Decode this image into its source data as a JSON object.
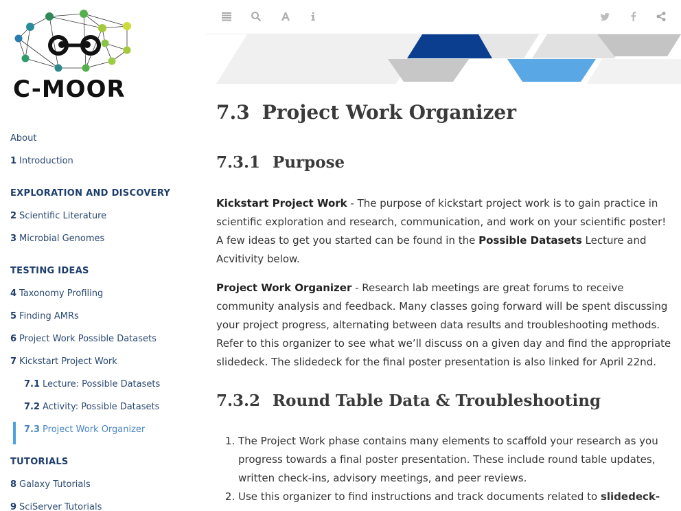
{
  "logo": {
    "text": "C-MOOR"
  },
  "sidebar": {
    "items": [
      {
        "kind": "entry",
        "num": "",
        "label": "About"
      },
      {
        "kind": "entry",
        "num": "1",
        "label": "Introduction"
      },
      {
        "kind": "gap"
      },
      {
        "kind": "part",
        "label": "Exploration and Discovery"
      },
      {
        "kind": "entry",
        "num": "2",
        "label": "Scientific Literature"
      },
      {
        "kind": "entry",
        "num": "3",
        "label": "Microbial Genomes"
      },
      {
        "kind": "gap"
      },
      {
        "kind": "part",
        "label": "Testing Ideas"
      },
      {
        "kind": "entry",
        "num": "4",
        "label": "Taxonomy Profiling"
      },
      {
        "kind": "entry",
        "num": "5",
        "label": "Finding AMRs"
      },
      {
        "kind": "entry",
        "num": "6",
        "label": "Project Work Possible Datasets"
      },
      {
        "kind": "entry",
        "num": "7",
        "label": "Kickstart Project Work"
      },
      {
        "kind": "sub",
        "num": "7.1",
        "label": "Lecture: Possible Datasets"
      },
      {
        "kind": "sub",
        "num": "7.2",
        "label": "Activity: Possible Datasets"
      },
      {
        "kind": "sub",
        "num": "7.3",
        "label": "Project Work Organizer",
        "active": true
      },
      {
        "kind": "gap"
      },
      {
        "kind": "part",
        "label": "Tutorials"
      },
      {
        "kind": "entry",
        "num": "8",
        "label": "Galaxy Tutorials"
      },
      {
        "kind": "entry",
        "num": "9",
        "label": "SciServer Tutorials"
      }
    ]
  },
  "toolbar": {
    "left_icons": [
      "toggle-sidebar-icon",
      "search-icon",
      "font-settings-icon",
      "info-icon"
    ],
    "right_icons": [
      "twitter-icon",
      "facebook-icon",
      "share-icon"
    ]
  },
  "main": {
    "chapter": {
      "num": "7.3",
      "title": "Project Work Organizer"
    },
    "sections": {
      "purpose": {
        "num": "7.3.1",
        "title": "Purpose"
      },
      "roundtable": {
        "num": "7.3.2",
        "title": "Round Table Data & Troubleshooting"
      }
    },
    "para1": {
      "bold1": "Kickstart Project Work",
      "text1": " - The purpose of kickstart project work is to gain practice in scientific exploration and research, communication, and work on your scientific poster! A few ideas to get you started can be found in the ",
      "bold2": "Possible Datasets",
      "text2": " Lecture and Acvitivity below."
    },
    "para2": {
      "bold1": "Project Work Organizer",
      "text1": " - Research lab meetings are great forums to receive community analysis and feedback. Many classes going forward will be spent discussing your project progress, alternating between data results and troubleshooting methods. Refer to this organizer to see what we’ll discuss on a given day and find the appropriate slidedeck. The slidedeck for the final poster presentation is also linked for April 22nd."
    },
    "list": {
      "item1": "The Project Work phase contains many elements to scaffold your research as you progress towards a final poster presentation. These include round table updates, written check-ins, advisory meetings, and peer reviews.",
      "item2_text": "Use this organizer to find instructions and track documents related to ",
      "item2_bold": "slidedeck-"
    }
  },
  "colors": {
    "sidebar_link": "#2b4a72",
    "active_link": "#4a86c5",
    "active_bar": "#4ea1e0",
    "banner_navy": "#0b3e8f",
    "banner_blue": "#5aa7e6",
    "banner_grey": "#c7c7c7"
  }
}
